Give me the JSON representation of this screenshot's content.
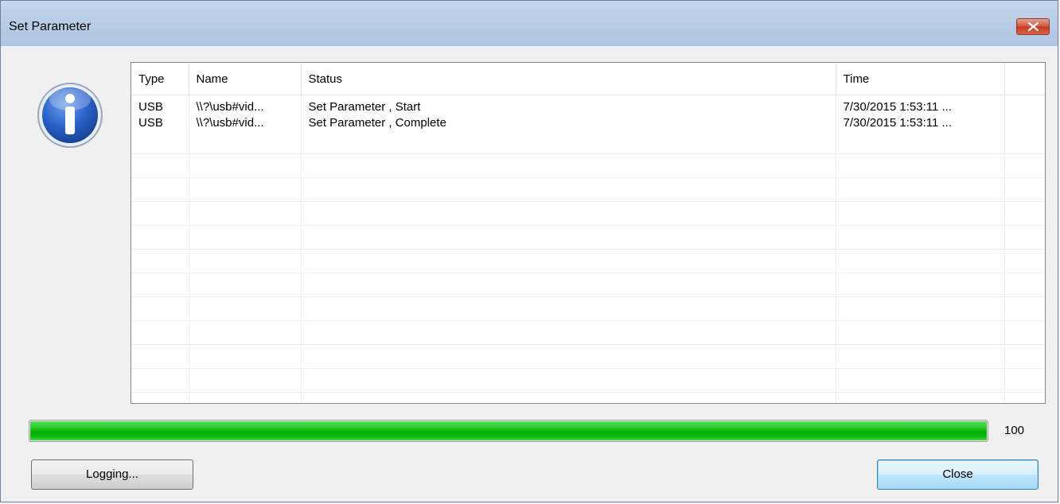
{
  "window": {
    "title": "Set Parameter"
  },
  "icons": {
    "info": "info-icon",
    "close": "close-icon"
  },
  "log_table": {
    "columns": [
      "Type",
      "Name",
      "Status",
      "Time",
      ""
    ],
    "rows": [
      {
        "type": "USB",
        "name": "\\\\?\\usb#vid...",
        "status": "Set Parameter , Start",
        "time": "7/30/2015 1:53:11 ..."
      },
      {
        "type": "USB",
        "name": "\\\\?\\usb#vid...",
        "status": "Set Parameter , Complete",
        "time": "7/30/2015 1:53:11 ..."
      }
    ]
  },
  "progress": {
    "percent": 100,
    "label": "100",
    "color": "#0cbb0c"
  },
  "buttons": {
    "logging_label": "Logging...",
    "close_label": "Close"
  },
  "colors": {
    "titlebar": "#b9cde6",
    "close_button": "#c6391f",
    "default_button_border": "#3c7fb1"
  }
}
